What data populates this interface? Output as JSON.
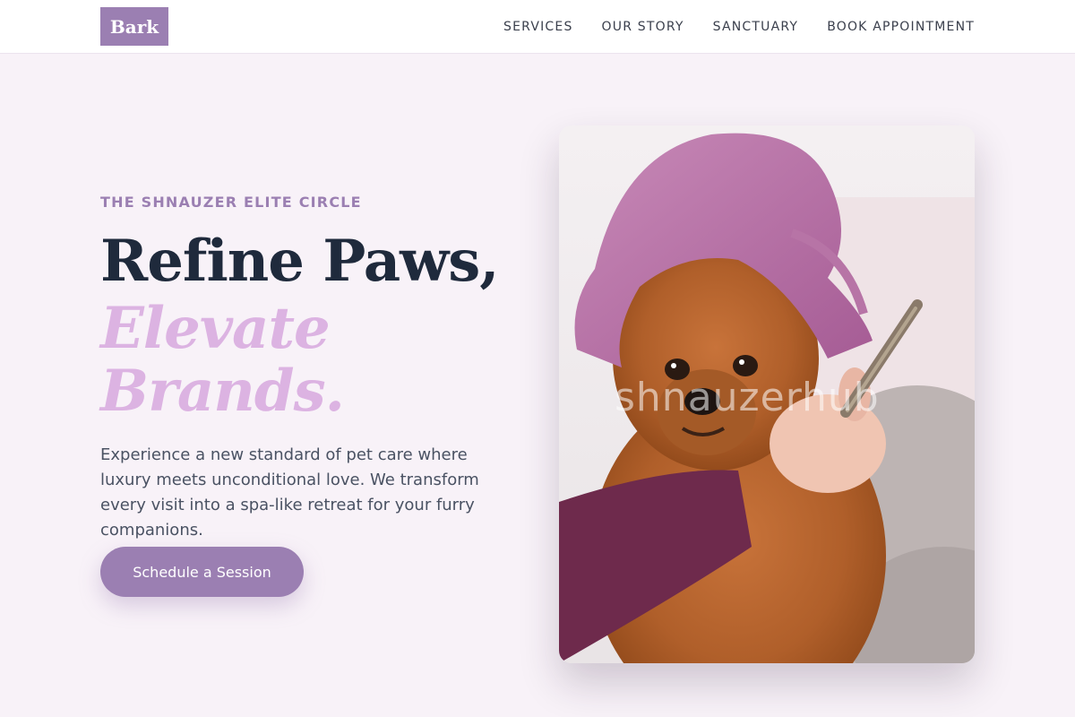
{
  "header": {
    "logo": "Bark",
    "nav": [
      "SERVICES",
      "OUR STORY",
      "SANCTUARY",
      "BOOK APPOINTMENT"
    ]
  },
  "hero": {
    "eyebrow": "THE SHNAUZER ELITE CIRCLE",
    "headline_line1": "Refine Paws,",
    "headline_line2": "Elevate",
    "headline_line3": "Brands.",
    "description": "Experience a new standard of pet care where luxury meets unconditional love. We transform every visit into a spa-like retreat for your furry companions.",
    "cta_label": "Schedule a Session",
    "image_watermark": "shnauzerhub"
  },
  "colors": {
    "brand": "#9b7fb2",
    "accent_light": "#dcb3e2",
    "heading": "#1f2a3c",
    "background": "#f8f2f8"
  }
}
